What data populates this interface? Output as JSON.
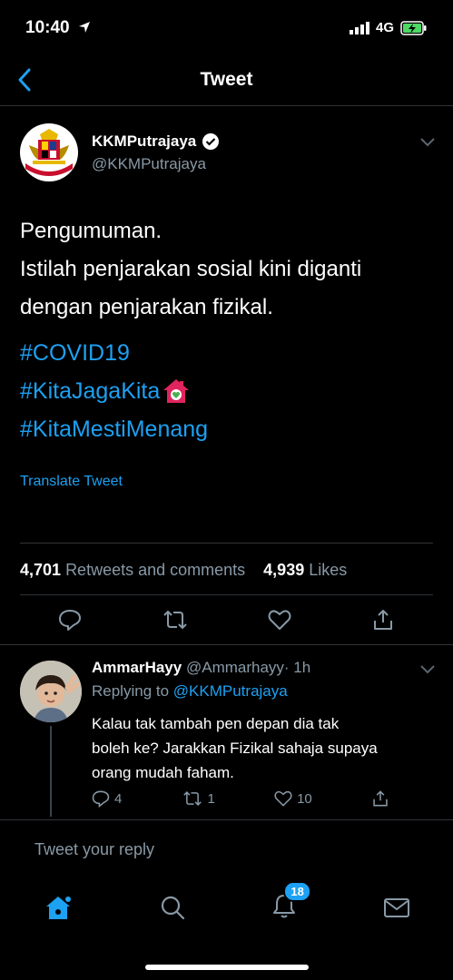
{
  "status": {
    "time": "10:40",
    "network": "4G"
  },
  "nav": {
    "title": "Tweet"
  },
  "tweet": {
    "author_name": "KKMPutrajaya",
    "author_handle": "@KKMPutrajaya",
    "avatar_text": "MENTERIAN KESIHATAN MALAYSIA",
    "lines": [
      "Pengumuman.",
      "Istilah penjarakan sosial kini diganti",
      "dengan penjarakan fizikal."
    ],
    "hashtags": [
      "#COVID19",
      "#KitaJagaKita",
      "#KitaMestiMenang"
    ],
    "house_emoji": "🏠",
    "translate_label": "Translate Tweet",
    "retweets_count": "4,701",
    "retweets_label": "Retweets and comments",
    "likes_count": "4,939",
    "likes_label": "Likes"
  },
  "reply": {
    "author_name": "AmmarHayy",
    "author_handle": "@Ammarhayy",
    "time": "· 1h",
    "replying_prefix": "Replying to",
    "replying_to": "@KKMPutrajaya",
    "lines": [
      "Kalau tak tambah pen depan dia tak",
      "boleh ke? Jarakkan Fizikal sahaja supaya",
      "orang mudah faham."
    ],
    "replies": "4",
    "retweets": "1",
    "likes": "10"
  },
  "compose": {
    "placeholder": "Tweet your reply"
  },
  "tabbar": {
    "notifications_badge": "18"
  },
  "colors": {
    "accent": "#1da1f2",
    "muted": "#8899a6",
    "background": "#000000"
  }
}
